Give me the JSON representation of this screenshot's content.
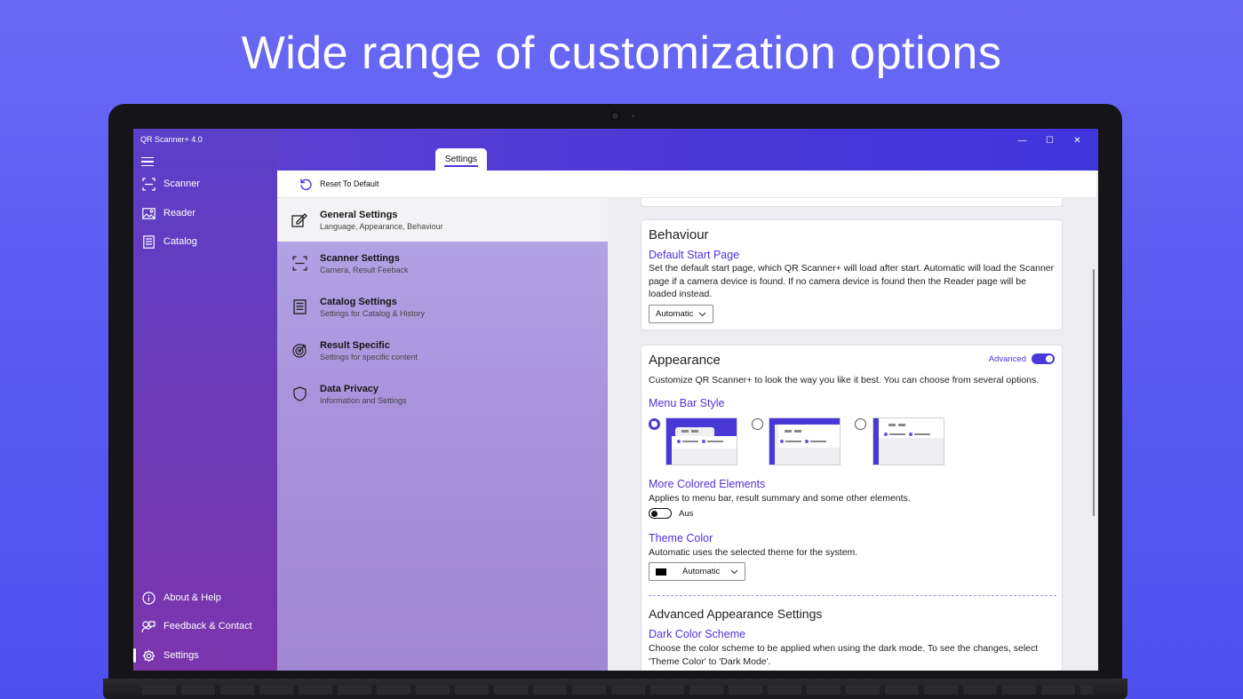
{
  "headline": "Wide range of customization options",
  "colors": {
    "accent": "#4a37d8",
    "link": "#5430d8"
  },
  "window": {
    "title": "QR Scanner+ 4.0",
    "controls": {
      "minimize": "—",
      "maximize": "☐",
      "close": "✕"
    }
  },
  "nav": {
    "items": [
      {
        "label": "Scanner",
        "icon": "scanner-icon"
      },
      {
        "label": "Reader",
        "icon": "image-icon"
      },
      {
        "label": "Catalog",
        "icon": "catalog-icon"
      }
    ],
    "footer": [
      {
        "label": "About & Help",
        "icon": "info-icon"
      },
      {
        "label": "Feedback & Contact",
        "icon": "feedback-icon"
      },
      {
        "label": "Settings",
        "icon": "gear-icon"
      }
    ]
  },
  "tab": {
    "label": "Settings"
  },
  "command_bar": {
    "reset_label": "Reset To Default"
  },
  "categories": [
    {
      "title": "General Settings",
      "subtitle": "Language, Appearance, Behaviour"
    },
    {
      "title": "Scanner Settings",
      "subtitle": "Camera, Result Feeback"
    },
    {
      "title": "Catalog Settings",
      "subtitle": "Settings for Catalog & History"
    },
    {
      "title": "Result Specific",
      "subtitle": "Settings for specific content"
    },
    {
      "title": "Data Privacy",
      "subtitle": "Information and Settings"
    }
  ],
  "behaviour": {
    "title": "Behaviour",
    "start_page_title": "Default Start Page",
    "start_page_desc": "Set the default start page, which QR Scanner+ will load after start. Automatic will load the Scanner page if a camera device is found. If no camera device is found then the Reader page will be loaded instead.",
    "start_page_value": "Automatic"
  },
  "appearance": {
    "title": "Appearance",
    "advanced_label": "Advanced",
    "advanced_on": true,
    "desc": "Customize QR Scanner+ to look the way you like it best. You can choose from several options.",
    "menu_bar_title": "Menu Bar Style",
    "selected_style": 1,
    "colored_title": "More Colored Elements",
    "colored_desc": "Applies to menu bar, result summary and some other elements.",
    "colored_state": "Aus",
    "theme_title": "Theme Color",
    "theme_desc": "Automatic uses the selected theme for the system.",
    "theme_value": "Automatic",
    "theme_swatch": "#000000"
  },
  "advanced": {
    "title": "Advanced Appearance Settings",
    "dark_scheme_title": "Dark Color Scheme",
    "dark_scheme_desc": "Choose the color scheme to be applied when using the dark mode. To see the changes, select 'Theme Color' to 'Dark Mode'."
  }
}
